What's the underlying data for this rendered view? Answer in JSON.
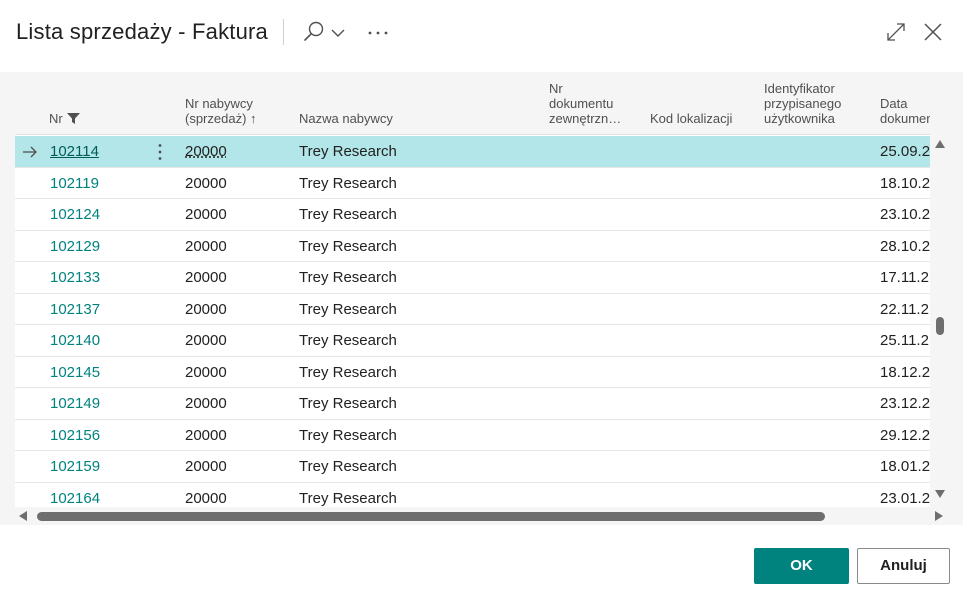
{
  "dialog": {
    "title": "Lista sprzedaży - Faktura"
  },
  "columns": {
    "nr": "Nr",
    "buyer_nr": "Nr nabywcy\n(sprzedaż)",
    "buyer_nr_sort": "↑",
    "buyer_name": "Nazwa nabywcy",
    "external_doc": "Nr\ndokumentu\nzewnętrzn…",
    "location_code": "Kod lokalizacji",
    "assigned_user": "Identyfikator\nprzypisanego\nużytkownika",
    "doc_date": "Data\ndokumentu"
  },
  "rows": [
    {
      "nr": "102114",
      "buyer_nr": "20000",
      "name": "Trey Research",
      "date": "25.09.2",
      "selected": true
    },
    {
      "nr": "102119",
      "buyer_nr": "20000",
      "name": "Trey Research",
      "date": "18.10.2"
    },
    {
      "nr": "102124",
      "buyer_nr": "20000",
      "name": "Trey Research",
      "date": "23.10.2"
    },
    {
      "nr": "102129",
      "buyer_nr": "20000",
      "name": "Trey Research",
      "date": "28.10.2"
    },
    {
      "nr": "102133",
      "buyer_nr": "20000",
      "name": "Trey Research",
      "date": "17.11.2"
    },
    {
      "nr": "102137",
      "buyer_nr": "20000",
      "name": "Trey Research",
      "date": "22.11.2"
    },
    {
      "nr": "102140",
      "buyer_nr": "20000",
      "name": "Trey Research",
      "date": "25.11.2"
    },
    {
      "nr": "102145",
      "buyer_nr": "20000",
      "name": "Trey Research",
      "date": "18.12.2"
    },
    {
      "nr": "102149",
      "buyer_nr": "20000",
      "name": "Trey Research",
      "date": "23.12.2"
    },
    {
      "nr": "102156",
      "buyer_nr": "20000",
      "name": "Trey Research",
      "date": "29.12.2"
    },
    {
      "nr": "102159",
      "buyer_nr": "20000",
      "name": "Trey Research",
      "date": "18.01.2"
    },
    {
      "nr": "102164",
      "buyer_nr": "20000",
      "name": "Trey Research",
      "date": "23.01.2"
    }
  ],
  "buttons": {
    "ok": "OK",
    "cancel": "Anuluj"
  },
  "colors": {
    "accent": "#00827f",
    "selected_row": "#b3e6e9"
  },
  "icons": [
    "search-icon",
    "chevron-down-icon",
    "more-icon",
    "expand-icon",
    "close-icon",
    "filter-icon",
    "arrow-right-icon",
    "row-menu-icon",
    "sort-up-icon"
  ]
}
